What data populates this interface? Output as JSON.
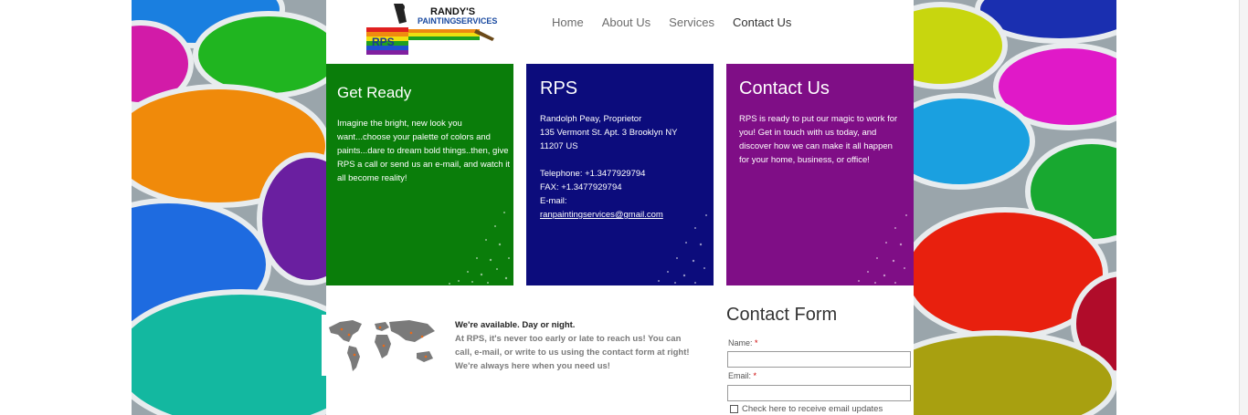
{
  "logo": {
    "line1": "RANDY'S",
    "line2": "PAINTING",
    "line3": "SERVICES",
    "mark": "RPS"
  },
  "nav": [
    {
      "label": "Home"
    },
    {
      "label": "About Us"
    },
    {
      "label": "Services"
    },
    {
      "label": "Contact Us"
    }
  ],
  "tiles": {
    "get_ready": {
      "title": "Get Ready",
      "body": "Imagine the bright, new look you\nwant...choose your palette of colors and\npaints...dare to dream bold things..then, give\nRPS a call or send us an e-mail, and watch it\nall become reality!"
    },
    "rps": {
      "title": "RPS",
      "body": "Randolph Peay, Proprietor\n135 Vermont St. Apt. 3 Brooklyn NY\n11207 US\n\nTelephone:        +1.3477929794\nFAX:                  +1.3477929794\nE-mail:",
      "email": "ranpaintingservices@gmail.com"
    },
    "contact": {
      "title": "Contact Us",
      "body": "RPS is ready to put our magic to work for you!  Get in touch with us today, and discover how we can make it all happen for your home, business, or office!"
    }
  },
  "availability": {
    "heading": "We're available. Day or night.",
    "text": "At RPS, it's never too early or late to reach us!  You can call, e-mail, or write to us using the contact form at right!  We're always here when you need us!"
  },
  "contact_form": {
    "title": "Contact Form",
    "name_label": "Name:",
    "email_label": "Email:",
    "required_mark": "*",
    "name_value": "",
    "email_value": "",
    "updates_label": "Check here to receive email updates"
  },
  "colors": {
    "green": "#0a7d0a",
    "blue": "#0c0c7c",
    "purple": "#7f0e86"
  }
}
